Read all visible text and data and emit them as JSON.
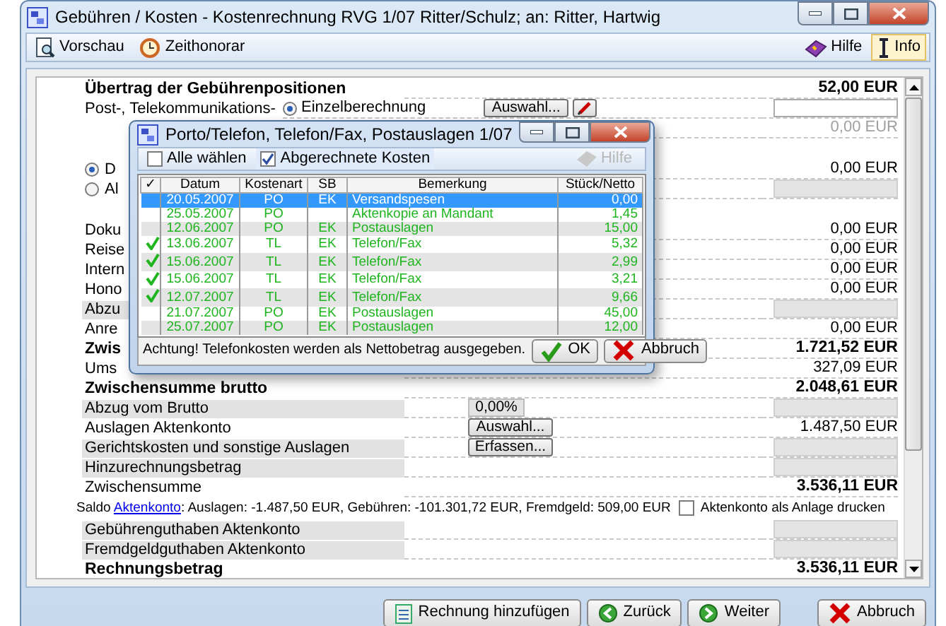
{
  "window": {
    "title": "Gebühren / Kosten - Kostenrechnung RVG 1/07 Ritter/Schulz; an: Ritter, Hartwig"
  },
  "toolbar": {
    "left": [
      {
        "label": "Vorschau"
      },
      {
        "label": "Zeithonorar"
      }
    ],
    "right": [
      {
        "label": "Hilfe",
        "selected": false
      },
      {
        "label": "Info",
        "selected": true
      }
    ]
  },
  "rows": [
    {
      "kind": "line",
      "label": "Übertrag der Gebührenpositionen",
      "label_bold": true,
      "amount": "52,00 EUR",
      "amount_bold": true
    },
    {
      "kind": "option",
      "label": "Post-, Telekommunikations-",
      "radio": {
        "label": "Einzelberechnung",
        "selected": true
      },
      "control": {
        "kind": "button",
        "label": "Auswahl..."
      },
      "pencil_button": true,
      "field": true
    },
    {
      "kind": "line",
      "amount": "0,00 EUR",
      "muted": true
    },
    {
      "kind": "radio",
      "label": "D",
      "selected": true,
      "amount": "0,00 EUR",
      "gap_before": true
    },
    {
      "kind": "radio",
      "label": "Al",
      "selected": false,
      "field": true
    },
    {
      "kind": "line",
      "label": "Doku",
      "amount": "0,00 EUR",
      "gap_before": true
    },
    {
      "kind": "line",
      "label": "Reise",
      "amount": "0,00 EUR"
    },
    {
      "kind": "line",
      "label": "Intern",
      "amount": "0,00 EUR"
    },
    {
      "kind": "line",
      "label": "Hono",
      "amount": "0,00 EUR"
    },
    {
      "kind": "line",
      "label": "Abzu",
      "shaded": true,
      "field": true
    },
    {
      "kind": "line",
      "label": "Anre",
      "amount": "0,00 EUR"
    },
    {
      "kind": "line",
      "label": "Zwis",
      "label_bold": true,
      "amount": "1.721,52 EUR",
      "amount_bold": true
    },
    {
      "kind": "line",
      "label": "Ums",
      "amount": "327,09 EUR"
    },
    {
      "kind": "line",
      "label": "Zwischensumme brutto",
      "label_bold": true,
      "amount": "2.048,61 EUR",
      "amount_bold": true
    },
    {
      "kind": "line",
      "label": "Abzug vom Brutto",
      "shaded": true,
      "control": {
        "kind": "percent",
        "value": "0,00%"
      },
      "field": true
    },
    {
      "kind": "line",
      "label": "Auslagen Aktenkonto",
      "control": {
        "kind": "button",
        "label": "Auswahl..."
      },
      "amount": "1.487,50 EUR"
    },
    {
      "kind": "line",
      "label": "Gerichtskosten und sonstige Auslagen",
      "shaded": true,
      "control": {
        "kind": "button",
        "label": "Erfassen..."
      },
      "field": true
    },
    {
      "kind": "line",
      "label": "Hinzurechnungsbetrag",
      "shaded": true,
      "field": true
    },
    {
      "kind": "line",
      "label": "Zwischensumme",
      "amount": "3.536,11 EUR",
      "amount_bold": true
    },
    {
      "kind": "saldo",
      "prefix": "Saldo",
      "link": "Aktenkonto",
      "text": ": Auslagen: -1.487,50 EUR, Gebühren: -101.301,72 EUR, Fremdgeld: 509,00 EUR",
      "checkbox": {
        "label": "Aktenkonto als Anlage drucken",
        "checked": false
      }
    },
    {
      "kind": "line",
      "label": "Gebührenguthaben Aktenkonto",
      "shaded": true,
      "field": true
    },
    {
      "kind": "line",
      "label": "Fremdgeldguthaben Aktenkonto",
      "shaded": true,
      "field": true
    },
    {
      "kind": "line",
      "label": "Rechnungsbetrag",
      "label_bold": true,
      "amount": "3.536,11 EUR",
      "amount_bold": true
    }
  ],
  "dialog": {
    "title": "Porto/Telefon, Telefon/Fax, Postauslagen 1/07",
    "options": [
      {
        "label": "Alle wählen",
        "checked": false
      },
      {
        "label": "Abgerechnete Kosten",
        "checked": true
      }
    ],
    "help": {
      "label": "Hilfe",
      "disabled": true
    },
    "columns": [
      "✓",
      "Datum",
      "Kostenart",
      "SB",
      "Bemerkung",
      "Stück/Netto"
    ],
    "rows": [
      {
        "checked": false,
        "selected": true,
        "datum": "20.05.2007",
        "kostenart": "PO",
        "sb": "EK",
        "bemerkung": "Versandspesen",
        "netto": "0,00"
      },
      {
        "checked": false,
        "selected": false,
        "datum": "25.05.2007",
        "kostenart": "PO",
        "bemerkung": "Aktenkopie an Mandant",
        "netto": "1,45"
      },
      {
        "checked": false,
        "selected": false,
        "datum": "12.06.2007",
        "kostenart": "PO",
        "sb": "EK",
        "bemerkung": "Postauslagen",
        "netto": "15,00"
      },
      {
        "checked": true,
        "selected": false,
        "datum": "13.06.2007",
        "kostenart": "TL",
        "sb": "EK",
        "bemerkung": "Telefon/Fax",
        "netto": "5,32"
      },
      {
        "checked": true,
        "selected": false,
        "datum": "15.06.2007",
        "kostenart": "TL",
        "sb": "EK",
        "bemerkung": "Telefon/Fax",
        "netto": "2,99"
      },
      {
        "checked": true,
        "selected": false,
        "datum": "15.06.2007",
        "kostenart": "TL",
        "sb": "EK",
        "bemerkung": "Telefon/Fax",
        "netto": "3,21"
      },
      {
        "checked": true,
        "selected": false,
        "datum": "12.07.2007",
        "kostenart": "TL",
        "sb": "EK",
        "bemerkung": "Telefon/Fax",
        "netto": "9,66"
      },
      {
        "checked": false,
        "selected": false,
        "datum": "21.07.2007",
        "kostenart": "PO",
        "sb": "EK",
        "bemerkung": "Postauslagen",
        "netto": "45,00"
      },
      {
        "checked": false,
        "selected": false,
        "datum": "25.07.2007",
        "kostenart": "PO",
        "sb": "EK",
        "bemerkung": "Postauslagen",
        "netto": "12,00"
      }
    ],
    "note": "Achtung! Telefonkosten werden als Nettobetrag ausgegeben.",
    "buttons": [
      {
        "label": "OK"
      },
      {
        "label": "Abbruch"
      }
    ]
  },
  "footer_buttons": [
    {
      "label": "Rechnung hinzufügen"
    },
    {
      "label": "Zurück"
    },
    {
      "label": "Weiter"
    },
    {
      "label": "Abbruch"
    }
  ]
}
